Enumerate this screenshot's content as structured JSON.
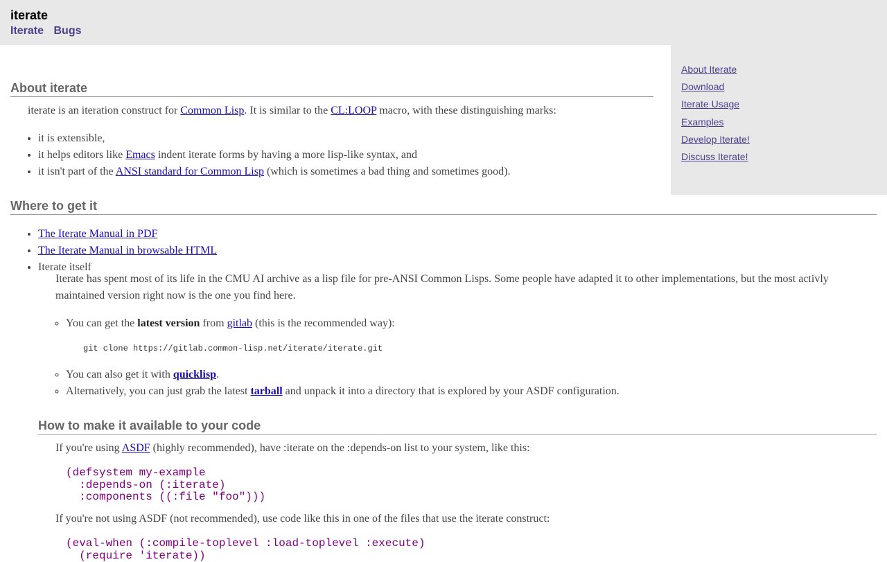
{
  "header": {
    "title": "iterate",
    "nav": [
      "Iterate",
      "Bugs"
    ]
  },
  "sidebar": {
    "links": [
      "About Iterate",
      "Download",
      "Iterate Usage",
      "Examples",
      "Develop Iterate!",
      "Discuss Iterate!"
    ]
  },
  "about": {
    "heading": "About iterate",
    "intro": {
      "t1": "iterate is an iteration construct for ",
      "link1": "Common Lisp",
      "t2": ". It is similar to the ",
      "link2": "CL:LOOP",
      "t3": " macro, with these distinguishing marks:"
    },
    "marks": {
      "m1": "it is extensible,",
      "m2_pre": "it helps editors like ",
      "m2_link": "Emacs",
      "m2_post": " indent iterate forms by having a more lisp-like syntax, and",
      "m3_pre": "it isn't part of the ",
      "m3_link": "ANSI standard for Common Lisp",
      "m3_post": " (which is sometimes a bad thing and sometimes good)."
    }
  },
  "where": {
    "heading": "Where to get it",
    "manual_pdf": "The Iterate Manual in PDF",
    "manual_html": "The Iterate Manual in browsable HTML",
    "itself": "Iterate itself",
    "desc": "Iterate has spent most of its life in the CMU AI archive as a lisp file for pre-ANSI Common Lisps. Some people have adapted it to other implementations, but the most activly maintained version right now is the one you find here.",
    "opt1_pre": "You can get the ",
    "opt1_bold": "latest version",
    "opt1_mid": " from ",
    "opt1_link": "gitlab",
    "opt1_post": " (this is the recommended way):",
    "git_cmd": "git clone https://gitlab.common-lisp.net/iterate/iterate.git",
    "opt2_pre": "You can also get it with ",
    "opt2_link": "quicklisp",
    "opt2_post": ".",
    "opt3_pre": "Alternatively, you can just grab the latest ",
    "opt3_link": "tarball",
    "opt3_post": " and unpack it into a directory that is explored by your ASDF configuration."
  },
  "howto": {
    "heading": "How to make it available to your code",
    "asdf_pre": "If you're using ",
    "asdf_link": "ASDF",
    "asdf_post": " (highly recommended), have :iterate on the :depends-on list to your system, like this:",
    "code1": "(defsystem my-example\n  :depends-on (:iterate)\n  :components ((:file \"foo\")))",
    "noasdf": "If you're not using ASDF (not recommended), use code like this in one of the files that use the iterate construct:",
    "code2": "(eval-when (:compile-toplevel :load-toplevel :execute)\n  (require 'iterate))"
  }
}
